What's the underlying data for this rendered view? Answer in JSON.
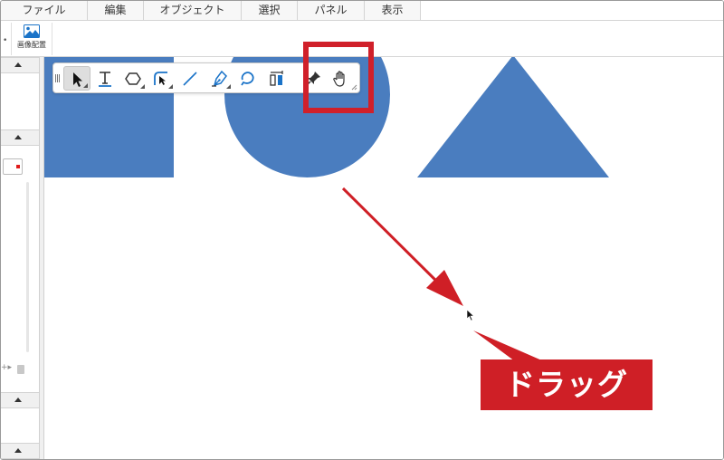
{
  "menubar": {
    "items": [
      {
        "label": "ファイル"
      },
      {
        "label": "編集"
      },
      {
        "label": "オブジェクト"
      },
      {
        "label": "選択"
      },
      {
        "label": "パネル"
      },
      {
        "label": "表示"
      }
    ]
  },
  "ribbon": {
    "place_image_label": "画像配置",
    "place_image_icon": "image-icon"
  },
  "toolbar": {
    "tools": [
      {
        "name": "select-tool",
        "icon": "arrow-cursor-icon",
        "active": true
      },
      {
        "name": "text-tool",
        "icon": "text-icon",
        "active": false
      },
      {
        "name": "shape-tool",
        "icon": "hexagon-icon",
        "active": false
      },
      {
        "name": "corner-tool",
        "icon": "corner-arrow-icon",
        "active": false
      },
      {
        "name": "line-tool",
        "icon": "line-icon",
        "active": false
      },
      {
        "name": "pen-tool",
        "icon": "pen-nib-icon",
        "active": false
      },
      {
        "name": "lasso-tool",
        "icon": "lasso-icon",
        "active": false
      },
      {
        "name": "transform-tool",
        "icon": "bar-transform-icon",
        "active": false
      },
      {
        "name": "pin-tool",
        "icon": "pushpin-icon",
        "active": false
      },
      {
        "name": "hand-tool",
        "icon": "hand-icon",
        "active": false
      }
    ]
  },
  "canvas": {
    "shape_color": "#4a7dbf",
    "shapes": [
      "square",
      "circle",
      "triangle"
    ]
  },
  "annotation": {
    "color": "#cf1f26",
    "drag_label": "ドラッグ"
  }
}
